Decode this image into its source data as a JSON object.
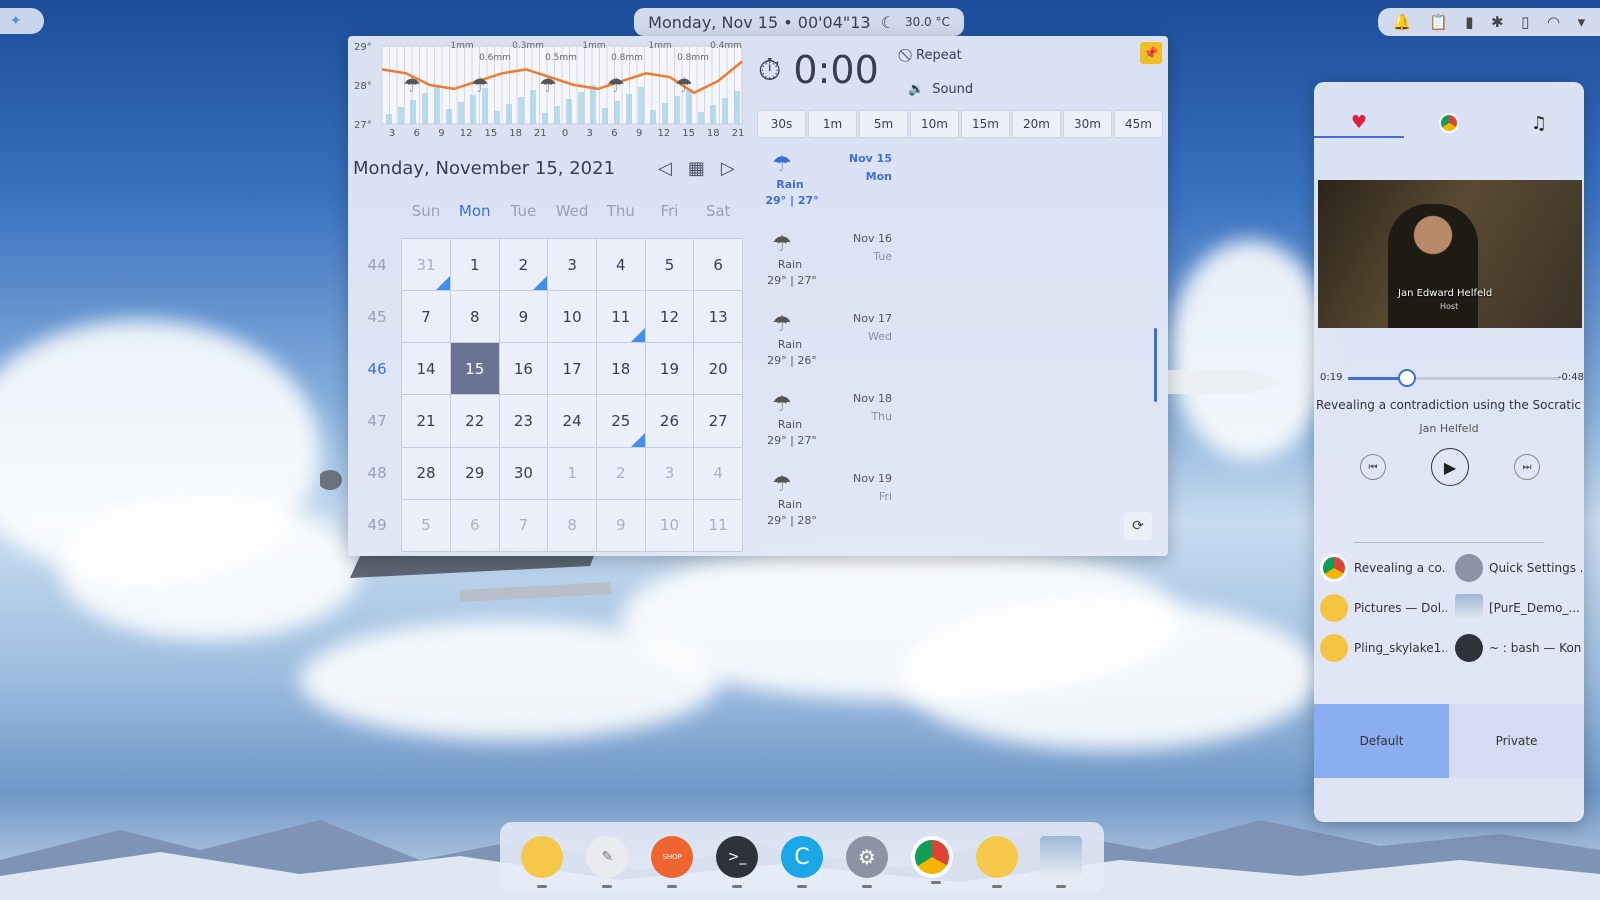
{
  "clock": {
    "text": "Monday, Nov 15 • 00'04\"13",
    "temp": "30.0 °C"
  },
  "weather_chart": {
    "y_ticks": [
      "29°",
      "28°",
      "27°"
    ],
    "x_ticks": [
      "3",
      "6",
      "9",
      "12",
      "15",
      "18",
      "21",
      "0",
      "3",
      "6",
      "9",
      "12",
      "15",
      "18",
      "21"
    ],
    "precip_labels": [
      "1mm",
      "0.6mm",
      "0.3mm",
      "0.5mm",
      "1mm",
      "0.8mm",
      "1mm",
      "0.8mm",
      "0.4mm",
      "0.8n"
    ],
    "temps": [
      28.4,
      28.3,
      28.0,
      27.9,
      28.1,
      28.3,
      28.4,
      28.2,
      28.0,
      27.9,
      28.1,
      28.3,
      28.2,
      27.8,
      28.1,
      28.6
    ]
  },
  "calendar": {
    "title": "Monday, November 15, 2021",
    "weekdays": [
      "Sun",
      "Mon",
      "Tue",
      "Wed",
      "Thu",
      "Fri",
      "Sat"
    ],
    "today_weekday_index": 1,
    "weeks": [
      {
        "num": "44",
        "days": [
          "31",
          "1",
          "2",
          "3",
          "4",
          "5",
          "6"
        ]
      },
      {
        "num": "45",
        "days": [
          "7",
          "8",
          "9",
          "10",
          "11",
          "12",
          "13"
        ]
      },
      {
        "num": "46",
        "days": [
          "14",
          "15",
          "16",
          "17",
          "18",
          "19",
          "20"
        ]
      },
      {
        "num": "47",
        "days": [
          "21",
          "22",
          "23",
          "24",
          "25",
          "26",
          "27"
        ]
      },
      {
        "num": "48",
        "days": [
          "28",
          "29",
          "30",
          "1",
          "2",
          "3",
          "4"
        ]
      },
      {
        "num": "49",
        "days": [
          "5",
          "6",
          "7",
          "8",
          "9",
          "10",
          "11"
        ]
      }
    ]
  },
  "timer": {
    "time": "0:00",
    "repeat": "Repeat",
    "sound": "Sound",
    "presets": [
      "30s",
      "1m",
      "5m",
      "10m",
      "15m",
      "20m",
      "30m",
      "45m"
    ]
  },
  "forecast": [
    {
      "cond": "Rain",
      "temp": "29° | 27°",
      "date": "Nov 15",
      "dow": "Mon"
    },
    {
      "cond": "Rain",
      "temp": "29° | 27°",
      "date": "Nov 16",
      "dow": "Tue"
    },
    {
      "cond": "Rain",
      "temp": "29° | 26°",
      "date": "Nov 17",
      "dow": "Wed"
    },
    {
      "cond": "Rain",
      "temp": "29° | 27°",
      "date": "Nov 18",
      "dow": "Thu"
    },
    {
      "cond": "Rain",
      "temp": "29° | 28°",
      "date": "Nov 19",
      "dow": "Fri"
    }
  ],
  "media": {
    "video_name": "Jan Edward Helfeld",
    "video_role": "Host",
    "elapsed": "0:19",
    "remaining": "-0:48",
    "progress_fraction": 0.28,
    "title": "Revealing a contradiction using the Socratic tec...",
    "artist": "Jan Helfeld"
  },
  "windows": [
    {
      "label": "Revealing a co...",
      "icon": "chrome-icon"
    },
    {
      "label": "Quick Settings ...",
      "icon": "settings-icon"
    },
    {
      "label": "Pictures — Dol...",
      "icon": "folder-icon"
    },
    {
      "label": "[PurE_Demo_...",
      "icon": "image-viewer-icon"
    },
    {
      "label": "Pling_skylake1...",
      "icon": "folder-icon"
    },
    {
      "label": "~ : bash — Kon...",
      "icon": "terminal-icon"
    }
  ],
  "activities": {
    "default": "Default",
    "private": "Private"
  },
  "dock": {
    "shop_label": "SHOP"
  },
  "colors": {
    "accent": "#3e6fd6",
    "event": "#3f8fef",
    "selected": "#6a7394"
  }
}
